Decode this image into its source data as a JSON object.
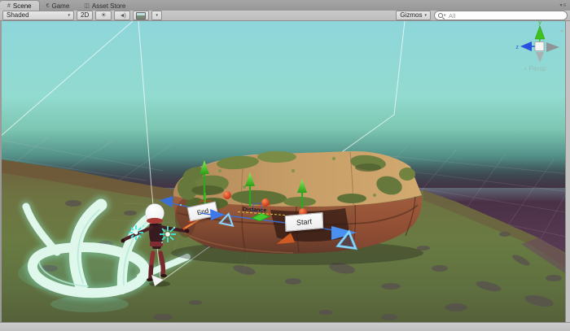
{
  "tab_bar": {
    "tabs": [
      {
        "icon": "#",
        "label": "Scene"
      },
      {
        "icon": "€",
        "label": "Game"
      },
      {
        "icon": "◫",
        "label": "Asset Store"
      }
    ],
    "menu_icon": "▾≡"
  },
  "toolbar": {
    "shading_dropdown": "Shaded",
    "dropdown_arrow": "▾",
    "toggle_2d": "2D",
    "gizmos_dropdown": "Gizmos",
    "search_placeholder": "All"
  },
  "scene": {
    "handle_labels": {
      "end": "End",
      "start": "Start",
      "distance": "Distance"
    },
    "view_gizmo": {
      "axis_y": "y",
      "axis_z": "z",
      "chevron": "‹",
      "projection": "Persp"
    },
    "colors": {
      "sky_top": "#8ed6da",
      "sky_teal": "#92dbd0",
      "horizon_purple": "#553650",
      "terrain_green": "#697b42",
      "crate_top": "#c79e67",
      "crate_front": "#8a4f33",
      "gizmo_green": "#3fc21c",
      "gizmo_red": "#e03c18",
      "path_blue": "#3a6fd6",
      "effect_cyan": "#bff2e2",
      "selection_white": "#ffffff"
    }
  }
}
